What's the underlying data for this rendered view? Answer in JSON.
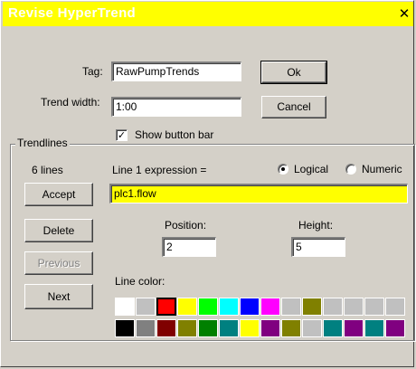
{
  "window": {
    "title": "Revise HyperTrend",
    "close_glyph": "✕",
    "titlebar_color": "#ffff00"
  },
  "form": {
    "tag_label": "Tag:",
    "tag_value": "RawPumpTrends",
    "trend_width_label": "Trend width:",
    "trend_width_value": "1:00",
    "show_button_bar_label": "Show button bar",
    "show_button_bar_checked": true,
    "ok_label": "Ok",
    "cancel_label": "Cancel"
  },
  "trendlines": {
    "group_title": "Trendlines",
    "count_label": "6 lines",
    "expression_label": "Line 1 expression =",
    "expression_value": "plc1.flow",
    "mode_logical_label": "Logical",
    "mode_numeric_label": "Numeric",
    "mode_selected": "Logical",
    "accept_label": "Accept",
    "delete_label": "Delete",
    "previous_label": "Previous",
    "next_label": "Next",
    "position_label": "Position:",
    "position_value": "2",
    "height_label": "Height:",
    "height_value": "5",
    "line_color_label": "Line color:",
    "palette": [
      [
        "#ffffff",
        "#c0c0c0",
        "#ff0000",
        "#ffff00",
        "#00ff00",
        "#00ffff",
        "#0000ff",
        "#ff00ff",
        "#c0c0c0",
        "#808000",
        "#c0c0c0",
        "#c0c0c0",
        "#c0c0c0",
        "#c0c0c0"
      ],
      [
        "#000000",
        "#808080",
        "#800000",
        "#808000",
        "#008000",
        "#008080",
        "#ffff00",
        "#800080",
        "#808000",
        "#c0c0c0",
        "#008080",
        "#800080",
        "#008080",
        "#800080"
      ]
    ],
    "selected_color": "#ff0000"
  }
}
